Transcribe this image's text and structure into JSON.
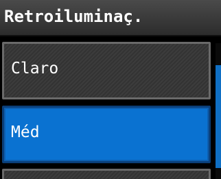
{
  "header": {
    "title": "Retroiluminaç."
  },
  "options": [
    {
      "label": "Claro",
      "selected": false
    },
    {
      "label": "Méd",
      "selected": true
    }
  ],
  "colors": {
    "selected_fill": "#0a72d1",
    "selected_border": "#0b3f79",
    "item_fill": "#363636",
    "item_border": "#6a6a6a",
    "scrollbar": "#0f6fc4"
  }
}
